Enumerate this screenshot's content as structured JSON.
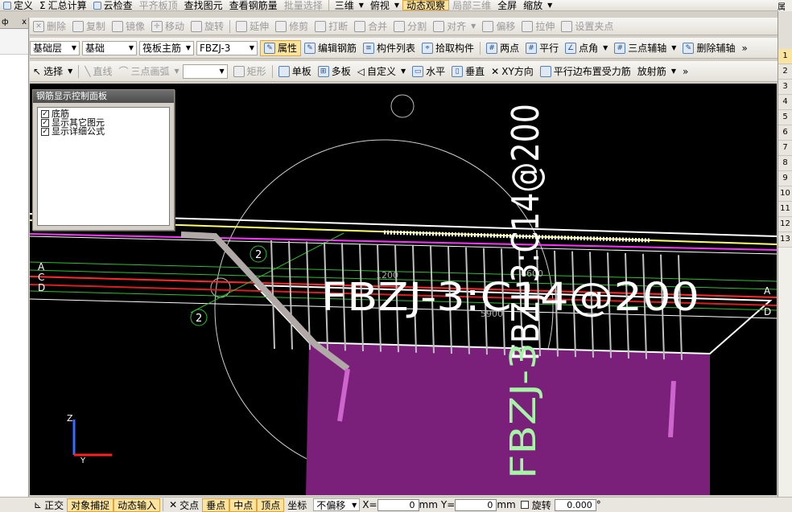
{
  "menubar": {
    "items": [
      "定义",
      "汇总计算",
      "云检查",
      "平齐板顶",
      "查找图元",
      "查看钢筋量",
      "批量选择",
      "三维",
      "俯视",
      "动态观察",
      "局部三维",
      "全屏",
      "缩放"
    ],
    "props_tab": "属性"
  },
  "toolbar2": {
    "items": [
      "删除",
      "复制",
      "镜像",
      "移动",
      "旋转",
      "延伸",
      "修剪",
      "打断",
      "合并",
      "分割",
      "对齐",
      "偏移",
      "拉伸",
      "设置夹点"
    ]
  },
  "toolbar3": {
    "floor": "基础层",
    "category": "基础",
    "type": "筏板主筋",
    "element": "FBZJ-3",
    "items": [
      "属性",
      "编辑钢筋",
      "构件列表",
      "拾取构件",
      "两点",
      "平行",
      "点角",
      "三点辅轴",
      "删除辅轴"
    ],
    "more": "»"
  },
  "toolbar4": {
    "select": "选择",
    "line": "直线",
    "arc": "三点画弧",
    "shape_value": "",
    "items": [
      "矩形",
      "单板",
      "多板",
      "自定义",
      "水平",
      "垂直",
      "XY方向",
      "平行边布置受力筋",
      "放射筋"
    ],
    "more": "»"
  },
  "left_panel": {
    "pin": "ф",
    "close": "x"
  },
  "right_panel": {
    "rows": [
      "1",
      "2",
      "3",
      "4",
      "5",
      "6",
      "7",
      "8",
      "9",
      "10",
      "11",
      "12",
      "13"
    ]
  },
  "rebar_panel": {
    "title": "钢筋显示控制面板",
    "options": [
      "底筋",
      "显示其它图元",
      "显示详细公式"
    ]
  },
  "drawing": {
    "label_horizontal": "FBZJ-3:C14@200",
    "label_vertical_white": "FBZJ-3:C14@200",
    "label_vertical_green": "FBZJ-3",
    "axis_circles": [
      "2",
      "2"
    ],
    "axis_letters": [
      "A",
      "C",
      "D"
    ],
    "dims": [
      "1200",
      "5900",
      "6600"
    ],
    "axis_z": "Z",
    "axis_y": "Y"
  },
  "statusbar": {
    "items": [
      "正交",
      "对象捕捉",
      "动态输入",
      "交点",
      "垂点",
      "中点",
      "顶点",
      "坐标"
    ],
    "offset_mode": "不偏移",
    "x_label": "X=",
    "x_value": "0",
    "y_label": "Y=",
    "y_value": "0",
    "unit": "mm",
    "rotate_label": "旋转",
    "rotate_value": "0.000",
    "degree": "°"
  },
  "colors": {
    "canvas": "#000000",
    "slab": "#7a1f7a",
    "active_btn": "#fbe4a0"
  }
}
